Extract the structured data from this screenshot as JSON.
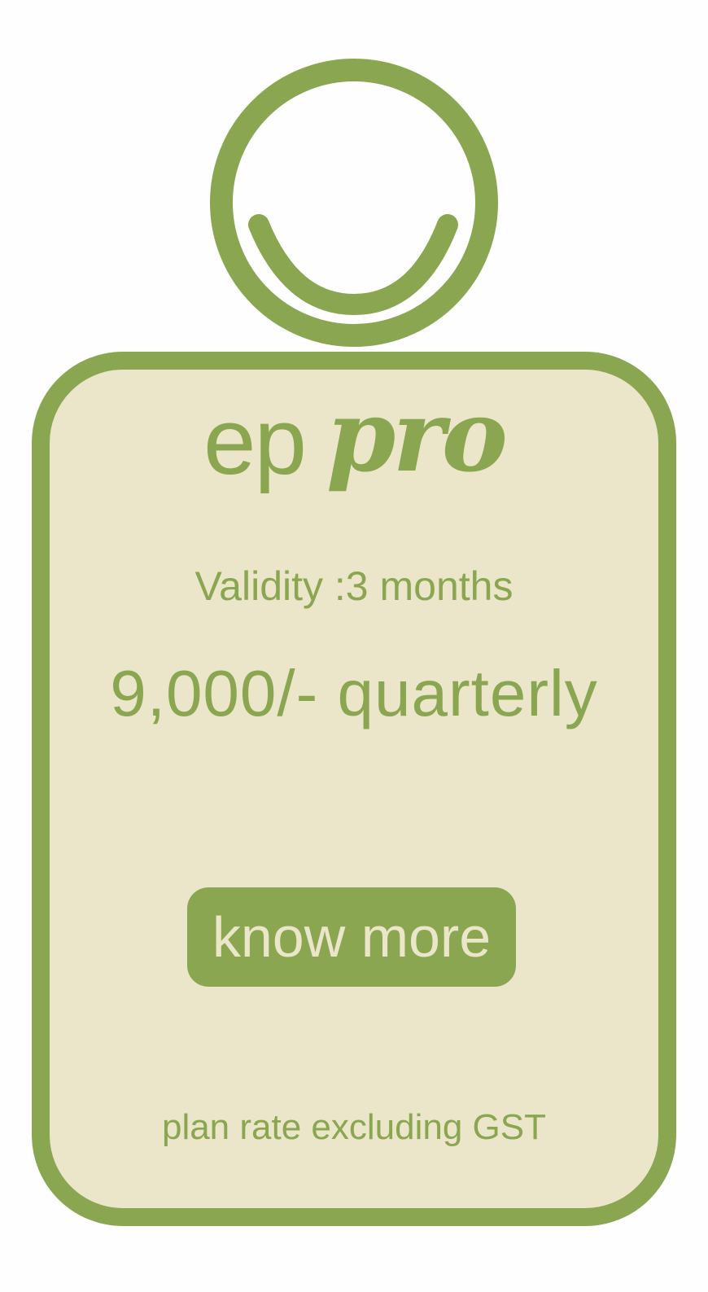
{
  "colors": {
    "accent": "#8aa650",
    "card_background": "#ebe6c9",
    "page_background": "#fefefe"
  },
  "logo": {
    "icon": "smiley-ring-icon"
  },
  "brand": {
    "prefix": "ep",
    "name": "pro"
  },
  "plan": {
    "validity": "Validity :3 months",
    "price": "9,000/- quarterly",
    "cta_label": "know more",
    "footnote": "plan rate excluding GST"
  }
}
